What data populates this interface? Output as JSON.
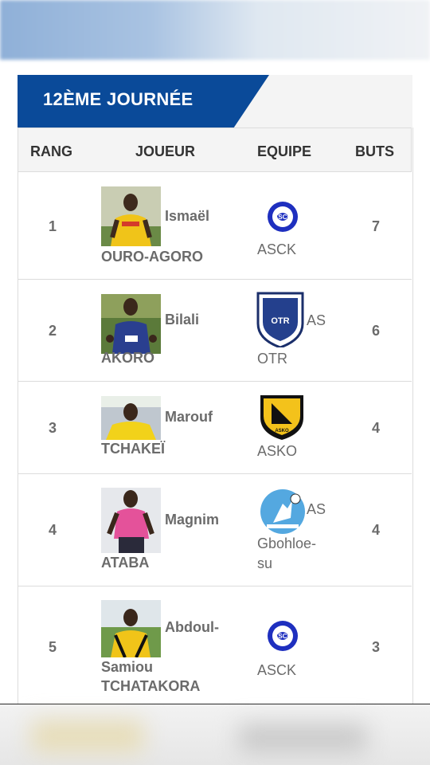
{
  "banner": {
    "title": "12ÈME JOURNÉE",
    "color": "#0a4a99"
  },
  "headers": {
    "rank": "RANG",
    "player": "JOUEUR",
    "team": "EQUIPE",
    "goals": "BUTS"
  },
  "rows": [
    {
      "rank": "1",
      "first": "Ismaël",
      "last": "OURO-AGORO",
      "team_l1": "",
      "team_l2": "ASCK",
      "team_l3": "",
      "goals": "7",
      "logo": "asck-logo-icon"
    },
    {
      "rank": "2",
      "first": "Bilali",
      "last": "AKORO",
      "team_l1": "AS",
      "team_l2": "OTR",
      "team_l3": "",
      "goals": "6",
      "logo": "otr-shield-icon"
    },
    {
      "rank": "3",
      "first": "Marouf",
      "last": "TCHAKEÏ",
      "team_l1": "",
      "team_l2": "ASKO",
      "team_l3": "",
      "goals": "4",
      "logo": "asko-shield-icon"
    },
    {
      "rank": "4",
      "first": "Magnim",
      "last": "ATABA",
      "team_l1": "AS",
      "team_l2": "Gbohloe-",
      "team_l3": "su",
      "goals": "4",
      "logo": "gbohloesu-logo-icon"
    },
    {
      "rank": "5",
      "first": "Abdoul-",
      "last": "Samiou",
      "last2": "TCHATAKORA",
      "team_l1": "",
      "team_l2": "ASCK",
      "team_l3": "",
      "goals": "3",
      "logo": "asck-logo-icon"
    }
  ]
}
